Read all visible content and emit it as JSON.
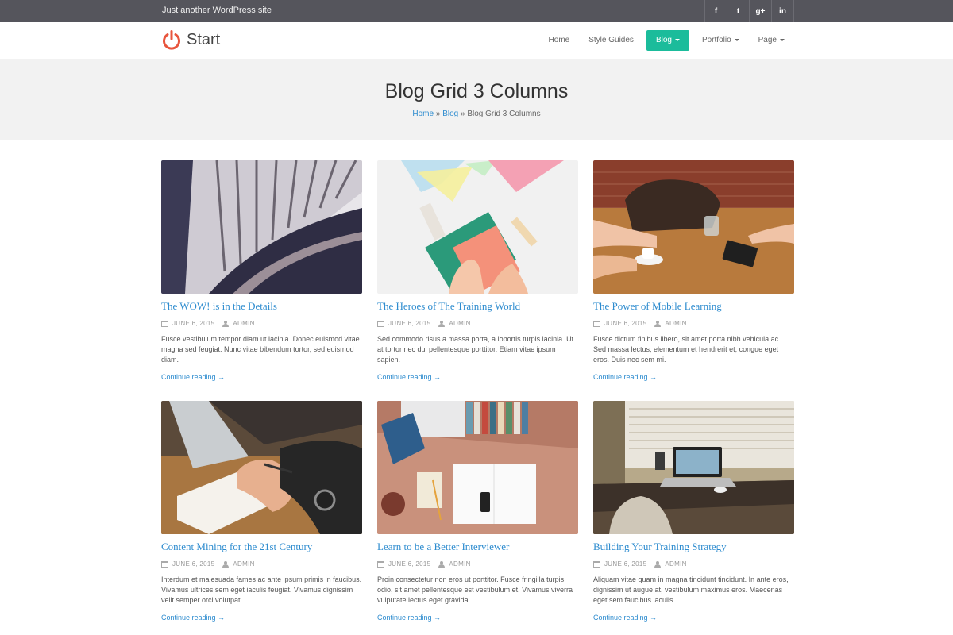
{
  "topbar": {
    "tagline": "Just another WordPress site",
    "socials": [
      {
        "icon": "facebook-icon",
        "glyph": "f"
      },
      {
        "icon": "twitter-icon",
        "glyph": "t"
      },
      {
        "icon": "google-plus-icon",
        "glyph": "g+"
      },
      {
        "icon": "linkedin-icon",
        "glyph": "in"
      }
    ]
  },
  "header": {
    "logo_text": "Start",
    "logo_icon": "power-icon",
    "logo_color": "#e8553d",
    "nav": [
      {
        "label": "Home"
      },
      {
        "label": "Style Guides"
      },
      {
        "label": "Blog"
      },
      {
        "label": "Portfolio"
      },
      {
        "label": "Page"
      }
    ],
    "accent": "#1bbc9b"
  },
  "page": {
    "title": "Blog Grid 3 Columns",
    "breadcrumb": {
      "home": "Home",
      "sep1": " » ",
      "blog": "Blog",
      "sep2": " » ",
      "current": "Blog Grid 3 Columns"
    }
  },
  "posts": [
    {
      "title": "The WOW! is in the Details",
      "date": "JUNE 6, 2015",
      "author": "ADMIN",
      "excerpt": "Fusce vestibulum tempor diam ut lacinia. Donec euismod vitae magna sed feugiat. Nunc vitae bibendum tortor, sed euismod diam.",
      "more": "Continue reading →",
      "image": "library-bookshelves"
    },
    {
      "title": "The Heroes of The Training World",
      "date": "JUNE 6, 2015",
      "author": "ADMIN",
      "excerpt": "Sed commodo risus a massa porta, a lobortis turpis lacinia. Ut at tortor nec dui pellentesque porttitor. Etiam vitae ipsum sapien.",
      "more": "Continue reading →",
      "image": "hands-on-cutting-mat"
    },
    {
      "title": "The Power of Mobile Learning",
      "date": "JUNE 6, 2015",
      "author": "ADMIN",
      "excerpt": "Fusce dictum finibus libero, sit amet porta nibh vehicula ac. Sed massa lectus, elementum et hendrerit et, congue eget eros. Duis nec sem mi.",
      "more": "Continue reading →",
      "image": "meeting-table-tablet"
    },
    {
      "title": "Content Mining for the 21st Century",
      "date": "JUNE 6, 2015",
      "author": "ADMIN",
      "excerpt": "Interdum et malesuada fames ac ante ipsum primis in faucibus. Vivamus ultrices sem eget iaculis feugiat. Vivamus dignissim velit semper orci volutpat.",
      "more": "Continue reading →",
      "image": "writing-notebook-laptop"
    },
    {
      "title": "Learn to be a Better Interviewer",
      "date": "JUNE 6, 2015",
      "author": "ADMIN",
      "excerpt": "Proin consectetur non eros ut porttitor. Fusce fringilla turpis odio, sit amet pellentesque est vestibulum et. Vivamus viverra vulputate lectus eget gravida.",
      "more": "Continue reading →",
      "image": "design-desk-top-view"
    },
    {
      "title": "Building Your Training Strategy",
      "date": "JUNE 6, 2015",
      "author": "ADMIN",
      "excerpt": "Aliquam vitae quam in magna tincidunt tincidunt. In ante eros, dignissim ut augue at, vestibulum maximus eros. Maecenas eget sem faucibus iaculis.",
      "more": "Continue reading →",
      "image": "laptop-by-window"
    }
  ]
}
